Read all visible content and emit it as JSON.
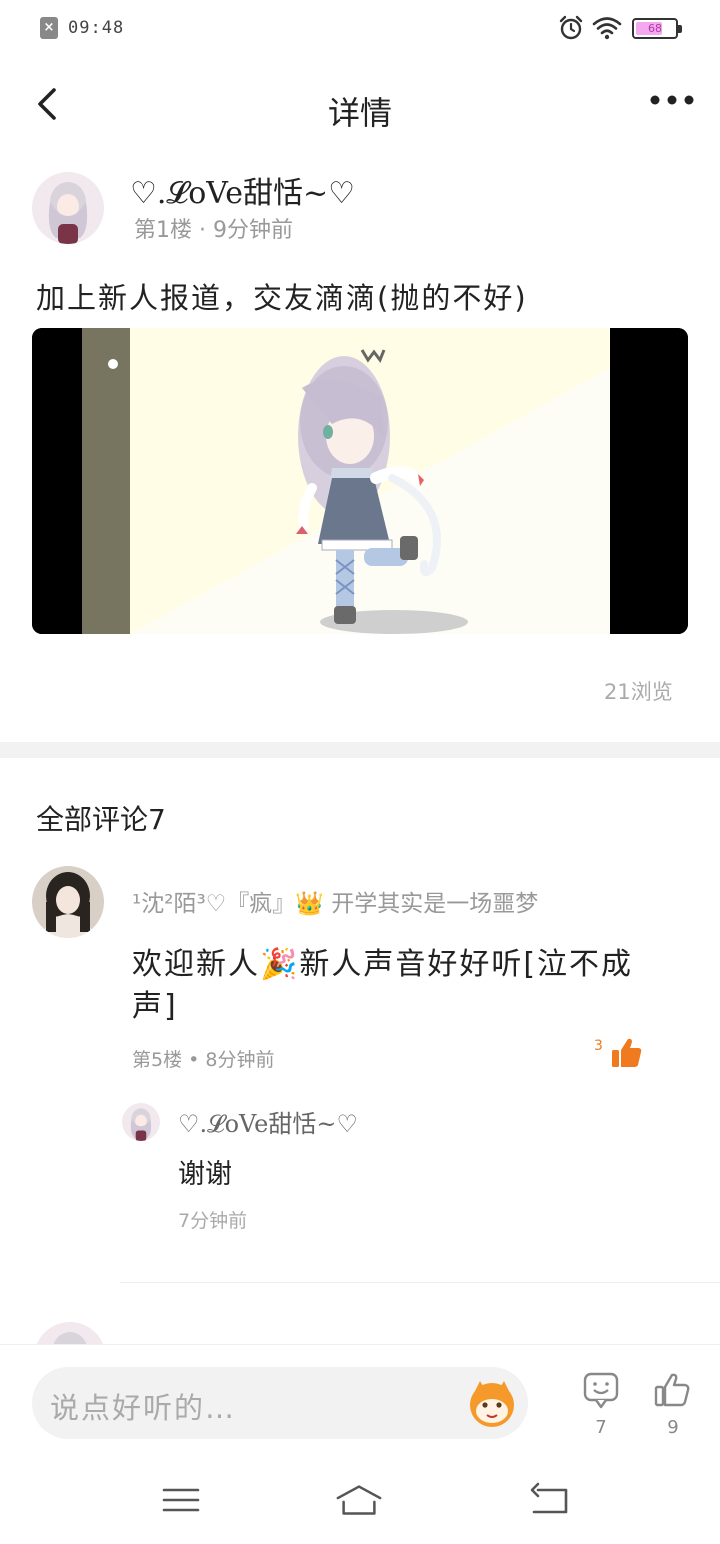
{
  "status_bar": {
    "time": "09:48",
    "battery": "68",
    "battery_level": 0.68,
    "notification_icon": "close-notification-icon"
  },
  "nav": {
    "title": "详情"
  },
  "post": {
    "author": "♡.𝓛oVe甜恬~♡",
    "meta": "第1楼 · 9分钟前",
    "text": "加上新人报道，交友滴滴(抛的不好)",
    "views": "21浏览"
  },
  "comments": {
    "title": "全部评论7",
    "items": [
      {
        "author": "¹沈²陌³♡『疯』👑 开学其实是一场噩梦",
        "text": "欢迎新人🎉新人声音好好听[泣不成声]",
        "meta": "第5楼 • 8分钟前",
        "likes": "3",
        "reply": {
          "author": "♡.𝓛oVe甜恬~♡",
          "text": "谢谢",
          "meta": "7分钟前"
        }
      }
    ]
  },
  "bottom_bar": {
    "placeholder": "说点好听的…",
    "comment_count": "7",
    "like_count": "9"
  },
  "colors": {
    "accent": "#f07a1e",
    "battery": "#f3a8ef",
    "muted_text": "#999999"
  }
}
